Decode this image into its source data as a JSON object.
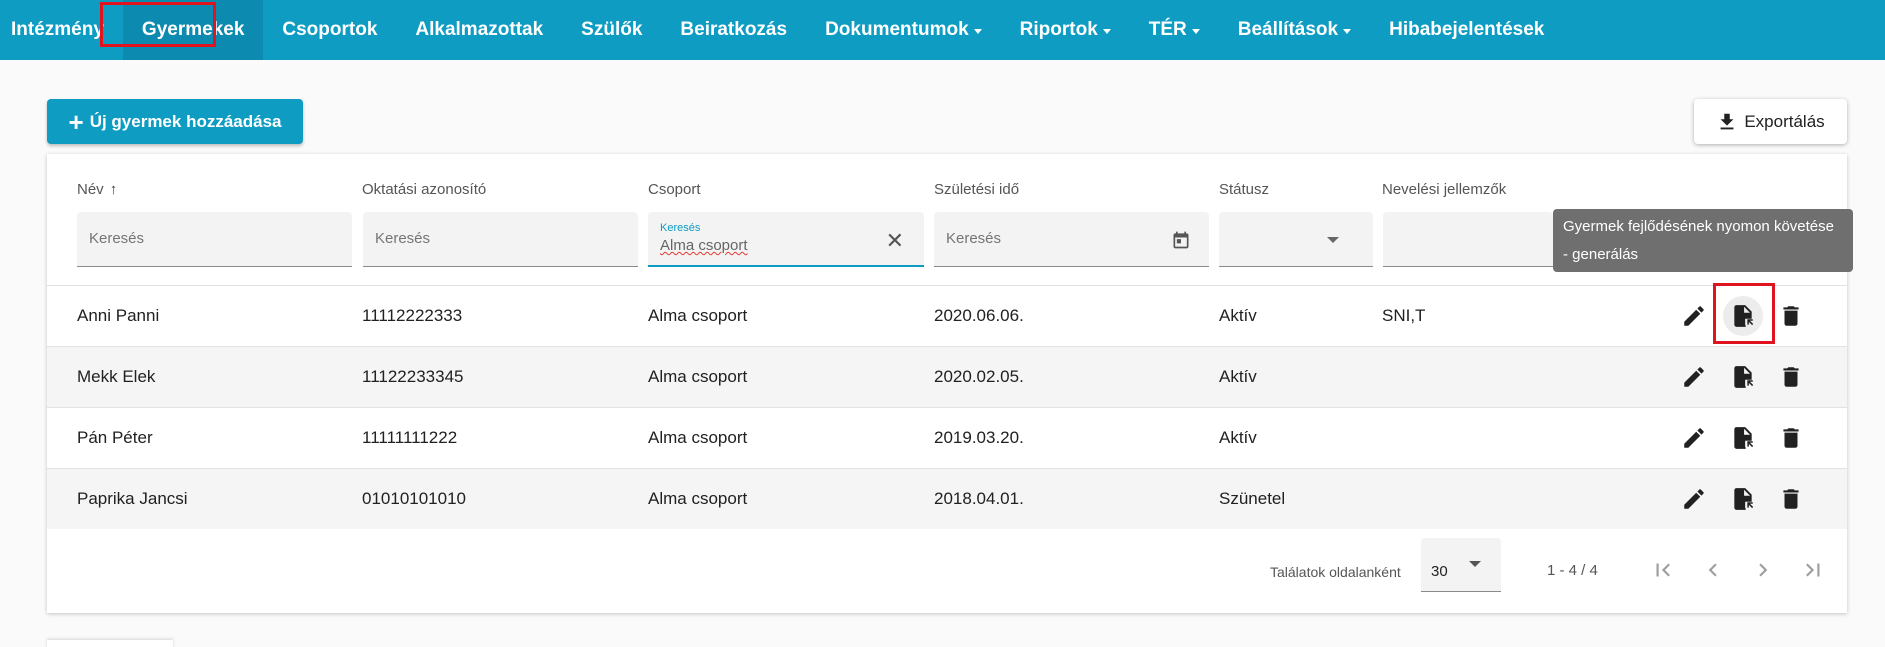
{
  "nav": {
    "items": [
      {
        "label": "Intézmény",
        "dropdown": false
      },
      {
        "label": "Gyermekek",
        "dropdown": false,
        "active": true
      },
      {
        "label": "Csoportok",
        "dropdown": false
      },
      {
        "label": "Alkalmazottak",
        "dropdown": false
      },
      {
        "label": "Szülők",
        "dropdown": false
      },
      {
        "label": "Beiratkozás",
        "dropdown": false
      },
      {
        "label": "Dokumentumok",
        "dropdown": true
      },
      {
        "label": "Riportok",
        "dropdown": true
      },
      {
        "label": "TÉR",
        "dropdown": true
      },
      {
        "label": "Beállítások",
        "dropdown": true
      },
      {
        "label": "Hibabejelentések",
        "dropdown": false
      }
    ]
  },
  "toolbar": {
    "add_label": "Új gyermek hozzáadása",
    "export_label": "Exportálás"
  },
  "table": {
    "columns": [
      "Név",
      "Oktatási azonosító",
      "Csoport",
      "Születési idő",
      "Státusz",
      "Nevelési jellemzők"
    ],
    "sort": {
      "column": "Név",
      "direction": "asc"
    },
    "filters": {
      "name_placeholder": "Keresés",
      "id_placeholder": "Keresés",
      "group_label": "Keresés",
      "group_value": "Alma csoport",
      "birth_placeholder": "Keresés"
    },
    "rows": [
      {
        "name": "Anni Panni",
        "id": "11112222333",
        "group": "Alma csoport",
        "birth": "2020.06.06.",
        "status": "Aktív",
        "traits": "SNI,T"
      },
      {
        "name": "Mekk Elek",
        "id": "11122233345",
        "group": "Alma csoport",
        "birth": "2020.02.05.",
        "status": "Aktív",
        "traits": ""
      },
      {
        "name": "Pán Péter",
        "id": "11111111222",
        "group": "Alma csoport",
        "birth": "2019.03.20.",
        "status": "Aktív",
        "traits": ""
      },
      {
        "name": "Paprika Jancsi",
        "id": "01010101010",
        "group": "Alma csoport",
        "birth": "2018.04.01.",
        "status": "Szünetel",
        "traits": ""
      }
    ]
  },
  "pagination": {
    "label": "Találatok oldalanként",
    "page_size": "30",
    "range": "1 - 4 / 4"
  },
  "tooltip": {
    "text": "Gyermek fejlődésének nyomon követése - generálás"
  },
  "colors": {
    "brand": "#0e9cc3",
    "highlight": "#e0141e"
  }
}
